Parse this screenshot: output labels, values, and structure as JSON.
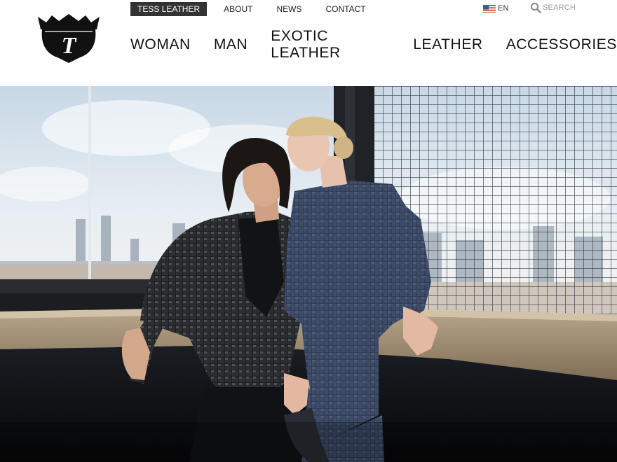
{
  "brand": {
    "logo_icon": "crown-shield-logo-icon",
    "logo_letter": "T"
  },
  "top_nav": [
    {
      "label": "TESS LEATHER",
      "active": true
    },
    {
      "label": "ABOUT",
      "active": false
    },
    {
      "label": "NEWS",
      "active": false
    },
    {
      "label": "CONTACT",
      "active": false
    }
  ],
  "language": {
    "icon": "us-flag-icon",
    "label": "EN"
  },
  "search": {
    "icon": "search-icon",
    "label": "SEARCH"
  },
  "main_nav": [
    {
      "label": "WOMAN"
    },
    {
      "label": "MAN"
    },
    {
      "label": "EXOTIC LEATHER"
    },
    {
      "label": "LEATHER"
    },
    {
      "label": "ACCESSORIES"
    }
  ],
  "hero": {
    "image": "couple-in-leather-outfits-by-window-photo"
  },
  "colors": {
    "active_tab_bg": "#333333",
    "active_tab_text": "#ffffff",
    "nav_text": "#111111",
    "search_text": "#9a9a9a"
  }
}
